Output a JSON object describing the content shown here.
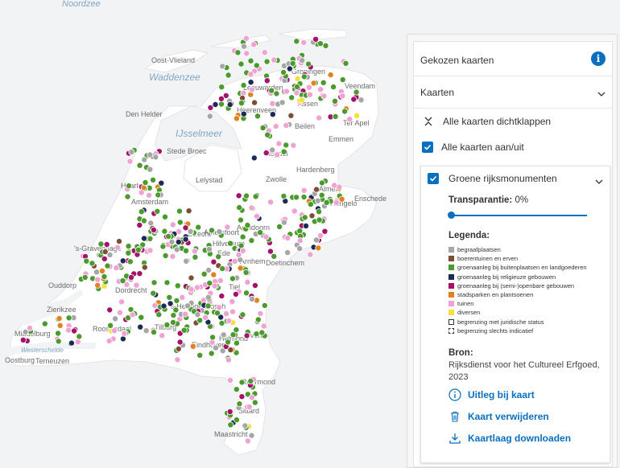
{
  "map": {
    "labels": {
      "noordzee": "Noordzee",
      "waddenzee": "Waddenzee",
      "ijsselmeer": "IJsselmeer",
      "westerschelde": "Westerschelde",
      "oost_vlieland": "Oost-Vlieland",
      "den_helder": "Den Helder",
      "stede_broec": "Stede Broec",
      "lelystad": "Lelystad",
      "amsterdam": "Amsterdam",
      "gravenhage": "'s-Gravenhage",
      "ouddorp": "Ouddorp",
      "zierikzee": "Zierikzee",
      "middelburg": "Middelburg",
      "oostburg": "Oostburg",
      "terneuzen": "Terneuzen",
      "roosendaal": "Roosendaal",
      "tilburg": "Tilburg",
      "eindhoven": "Eindhoven",
      "helmond": "Helmond",
      "venlo": "Venlo",
      "roermond": "Roermond",
      "sittard": "Sittard",
      "maastricht": "Maastricht",
      "dordrecht": "Dordrecht",
      "s_hertogenbosch": "'s-Hertogenbosch",
      "utrecht": "Utrecht",
      "amersfoort": "Amersfoort",
      "apeldoorn": "Apeldoorn",
      "ede": "Ede",
      "arnhem": "Arnhem",
      "doetinchem": "Doetinchem",
      "zwolle": "Zwolle",
      "meppel": "Meppel",
      "hardenberg": "Hardenberg",
      "emmen": "Emmen",
      "beilen": "Beilen",
      "assen": "Assen",
      "ter_apel": "Ter Apel",
      "groningen": "Groningen",
      "veendam": "Veendam",
      "leeuwarden": "Leeuwarden",
      "heerenveen": "Heerenveen",
      "enschede": "Enschede",
      "hengelo": "Hengelo",
      "almelo": "Almelo",
      "haarlem": "Haarlem",
      "hilversum": "Hilversum",
      "tiel": "Tiel"
    }
  },
  "panel": {
    "title": "Gekozen kaarten",
    "info_icon": "info-icon",
    "section_label": "Kaarten",
    "collapse_all": "Alle kaarten dichtklappen",
    "toggle_all": "Alle kaarten aan/uit",
    "layer": {
      "name": "Groene rijksmonumenten",
      "transparency_label": "Transparantie:",
      "transparency_value": "0%",
      "transparency_fraction": 0.0,
      "legend_title": "Legenda:",
      "legend": [
        {
          "label": "begraafplaatsen",
          "color": "#a6a6a6",
          "style": "fill"
        },
        {
          "label": "boerentuinen en erven",
          "color": "#7b4f36",
          "style": "fill"
        },
        {
          "label": "groenaanleg bij buitenplaatsen en landgoederen",
          "color": "#4a9a2e",
          "style": "fill"
        },
        {
          "label": "groenaanleg bij religieuze gebouwen",
          "color": "#1d2a55",
          "style": "fill"
        },
        {
          "label": "groenaanleg bij (semi-)openbare gebouwen",
          "color": "#a4126a",
          "style": "fill"
        },
        {
          "label": "stadsparken en plantsoenen",
          "color": "#e0821e",
          "style": "fill"
        },
        {
          "label": "tuinen",
          "color": "#f0a2d2",
          "style": "fill"
        },
        {
          "label": "diversen",
          "color": "#f6e03c",
          "style": "fill"
        },
        {
          "label": "begrenzing met juridische status",
          "color": "#333333",
          "style": "outline"
        },
        {
          "label": "begrenzing slechts indicatief",
          "color": "#333333",
          "style": "dashed"
        }
      ],
      "source_title": "Bron:",
      "source_text": "Rijksdienst voor het Cultureel Erfgoed, 2023",
      "actions": {
        "explain": "Uitleg bij kaart",
        "remove": "Kaart verwijderen",
        "download": "Kaartlaag downloaden"
      }
    }
  },
  "colors": {
    "accent": "#0b6fbf",
    "water": "#f3f3f3",
    "land": "#ffffff"
  }
}
